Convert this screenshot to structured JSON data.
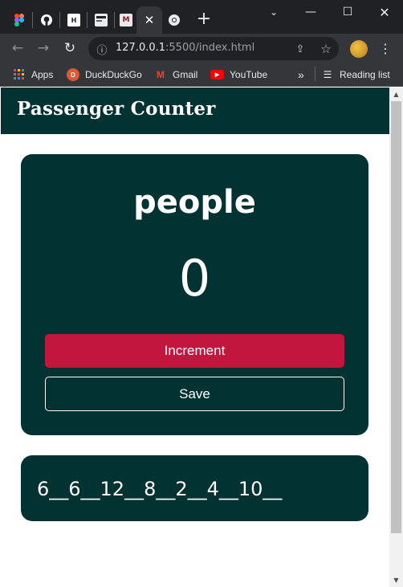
{
  "browser": {
    "tabs": [
      {
        "icon": "figma-icon"
      },
      {
        "icon": "github-icon"
      },
      {
        "icon": "hackerrank-icon"
      },
      {
        "icon": "site-icon"
      },
      {
        "icon": "app-icon"
      },
      {
        "icon": "chrome-icon",
        "active": true
      }
    ],
    "new_tab_label": "+",
    "url": {
      "host": "127.0.0.1",
      "rest": ":5500/index.html"
    },
    "bookmarks": [
      {
        "label": "Apps",
        "icon": "apps-grid-icon"
      },
      {
        "label": "DuckDuckGo",
        "icon": "duckduckgo-icon"
      },
      {
        "label": "Gmail",
        "icon": "gmail-icon"
      },
      {
        "label": "YouTube",
        "icon": "youtube-icon"
      }
    ],
    "overflow_label": "»",
    "reading_list_label": "Reading list"
  },
  "app": {
    "title": "Passenger Counter",
    "counter_label": "people",
    "counter_value": "0",
    "increment_label": "Increment",
    "save_label": "Save",
    "entries": "6__6__12__8__2__4__10__"
  },
  "colors": {
    "brand_dark": "#033233",
    "increment_red": "#c2163f",
    "text": "#ffffff"
  }
}
